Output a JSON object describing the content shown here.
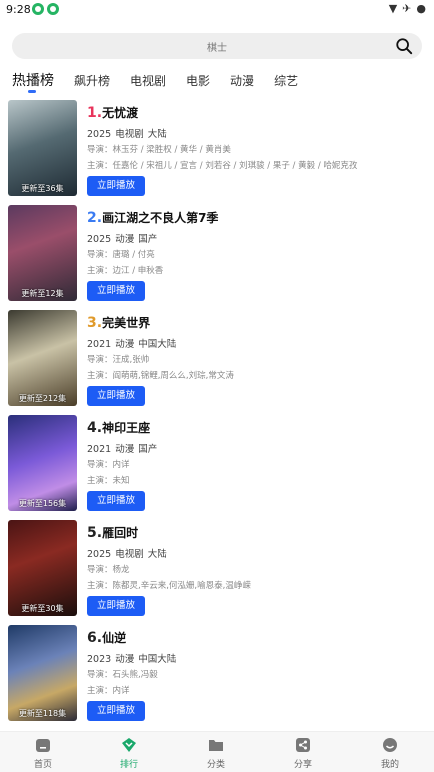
{
  "status": {
    "time": "9:28"
  },
  "search": {
    "placeholder": "棋士"
  },
  "tabs": [
    "热播榜",
    "飙升榜",
    "电视剧",
    "电影",
    "动漫",
    "综艺"
  ],
  "play_label": "立即播放",
  "director_prefix": "导演：",
  "cast_prefix": "主演：",
  "items": [
    {
      "rank": "1.",
      "title": "无忧渡",
      "year": "2025",
      "genre": "电视剧",
      "region": "大陆",
      "director": "林玉芬 / 梁胜权 / 黄华 / 黄肖美",
      "cast": "任嘉伦 / 宋祖儿 / 宣言 / 刘若谷 / 刘琪骏 / 果子 / 黄毅 / 哈妮克孜",
      "caption": "更新至36集",
      "rank_color": "#e8345b"
    },
    {
      "rank": "2.",
      "title": "画江湖之不良人第7季",
      "year": "2025",
      "genre": "动漫",
      "region": "国产",
      "director": "唐璐 / 付亮",
      "cast": "边江 / 申秋香",
      "caption": "更新至12集",
      "rank_color": "#3a7bf2"
    },
    {
      "rank": "3.",
      "title": "完美世界",
      "year": "2021",
      "genre": "动漫",
      "region": "中国大陆",
      "director": "汪成,张帅",
      "cast": "阎萌萌,锦鲤,周么么,刘琮,常文涛",
      "caption": "更新至212集",
      "rank_color": "#e09a2b"
    },
    {
      "rank": "4.",
      "title": "神印王座",
      "year": "2021",
      "genre": "动漫",
      "region": "国产",
      "director": "内详",
      "cast": "未知",
      "caption": "更新至156集",
      "rank_color": "#222222"
    },
    {
      "rank": "5.",
      "title": "雁回时",
      "year": "2025",
      "genre": "电视剧",
      "region": "大陆",
      "director": "杨龙",
      "cast": "陈都灵,辛云来,何泓姗,喻恩泰,温峥嵘",
      "caption": "更新至30集",
      "rank_color": "#222222"
    },
    {
      "rank": "6.",
      "title": "仙逆",
      "year": "2023",
      "genre": "动漫",
      "region": "中国大陆",
      "director": "石头熊,冯毅",
      "cast": "内详",
      "caption": "更新至118集",
      "rank_color": "#222222"
    }
  ],
  "nav": [
    {
      "label": "首页",
      "icon": "home-icon"
    },
    {
      "label": "排行",
      "icon": "ranking-icon"
    },
    {
      "label": "分类",
      "icon": "folder-icon"
    },
    {
      "label": "分享",
      "icon": "share-icon"
    },
    {
      "label": "我的",
      "icon": "profile-icon"
    }
  ],
  "colors": {
    "accent": "#1d5cf5",
    "nav_active": "#1aa86b"
  }
}
